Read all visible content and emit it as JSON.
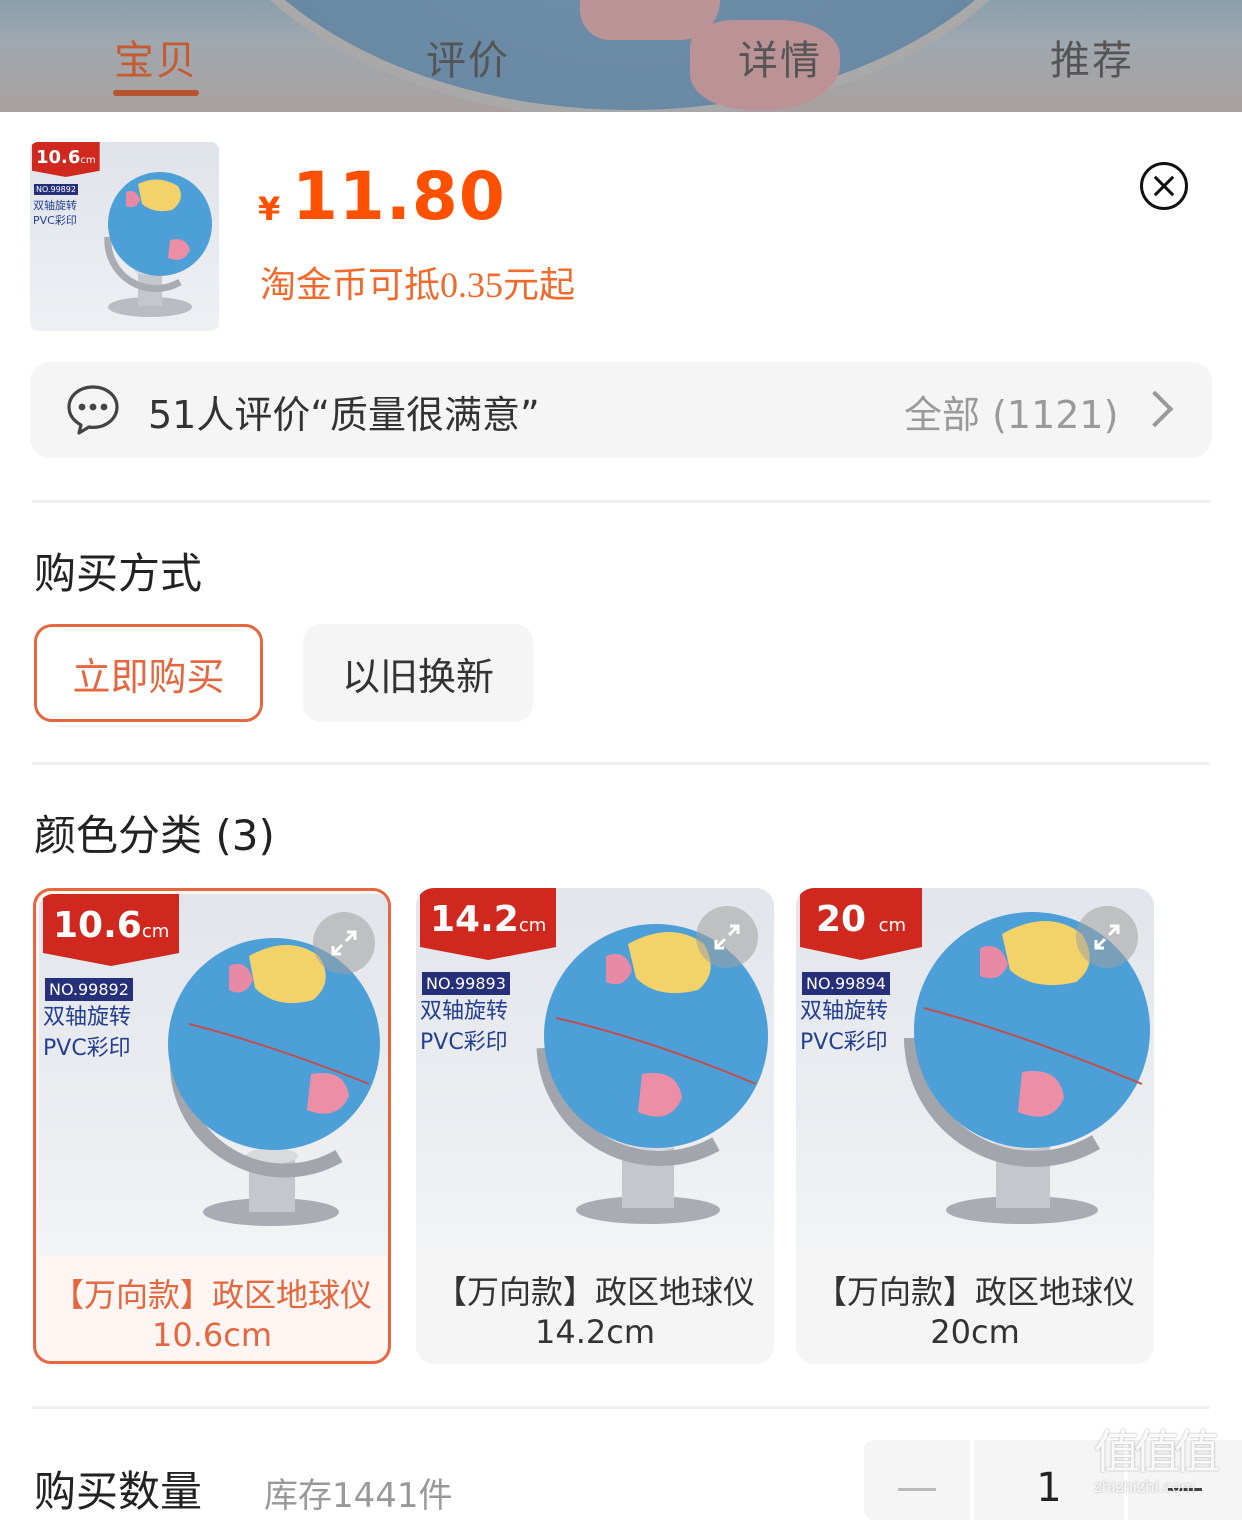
{
  "tabs": [
    {
      "label": "宝贝",
      "active": true
    },
    {
      "label": "评价",
      "active": false
    },
    {
      "label": "详情",
      "active": false
    },
    {
      "label": "推荐",
      "active": false
    }
  ],
  "product": {
    "price_symbol": "¥",
    "price": "11.80",
    "coin_note": "淘金币可抵0.35元起",
    "thumb": {
      "size_badge": "10.6",
      "unit": "cm",
      "no": "NO.99892",
      "line1": "双轴旋转",
      "line2": "PVC彩印"
    }
  },
  "review": {
    "summary": "51人评价“质量很满意”",
    "all_label": "全部 (1121)"
  },
  "purchase_method": {
    "title": "购买方式",
    "options": [
      {
        "label": "立即购买",
        "selected": true
      },
      {
        "label": "以旧换新",
        "selected": false
      }
    ]
  },
  "color_category": {
    "title": "颜色分类 (3)",
    "items": [
      {
        "size": "10.6",
        "unit": "cm",
        "no": "NO.99892",
        "line1": "双轴旋转",
        "line2": "PVC彩印",
        "name": "【万向款】政区地球仪",
        "spec": "10.6cm",
        "selected": true
      },
      {
        "size": "14.2",
        "unit": "cm",
        "no": "NO.99893",
        "line1": "双轴旋转",
        "line2": "PVC彩印",
        "name": "【万向款】政区地球仪",
        "spec": "14.2cm",
        "selected": false
      },
      {
        "size": "20",
        "unit": "cm",
        "no": "NO.99894",
        "line1": "双轴旋转",
        "line2": "PVC彩印",
        "name": "【万向款】政区地球仪",
        "spec": "20cm",
        "selected": false
      }
    ]
  },
  "quantity": {
    "title": "购买数量",
    "stock": "库存1441件",
    "minus": "—",
    "value": "1"
  },
  "watermark": {
    "chars": "值值值",
    "url": "zhizhizhi.com"
  },
  "colors": {
    "accent": "#ff5000",
    "selected_border": "#e4673f",
    "tab_active": "#c65a30",
    "badge_red": "#d0281e"
  }
}
